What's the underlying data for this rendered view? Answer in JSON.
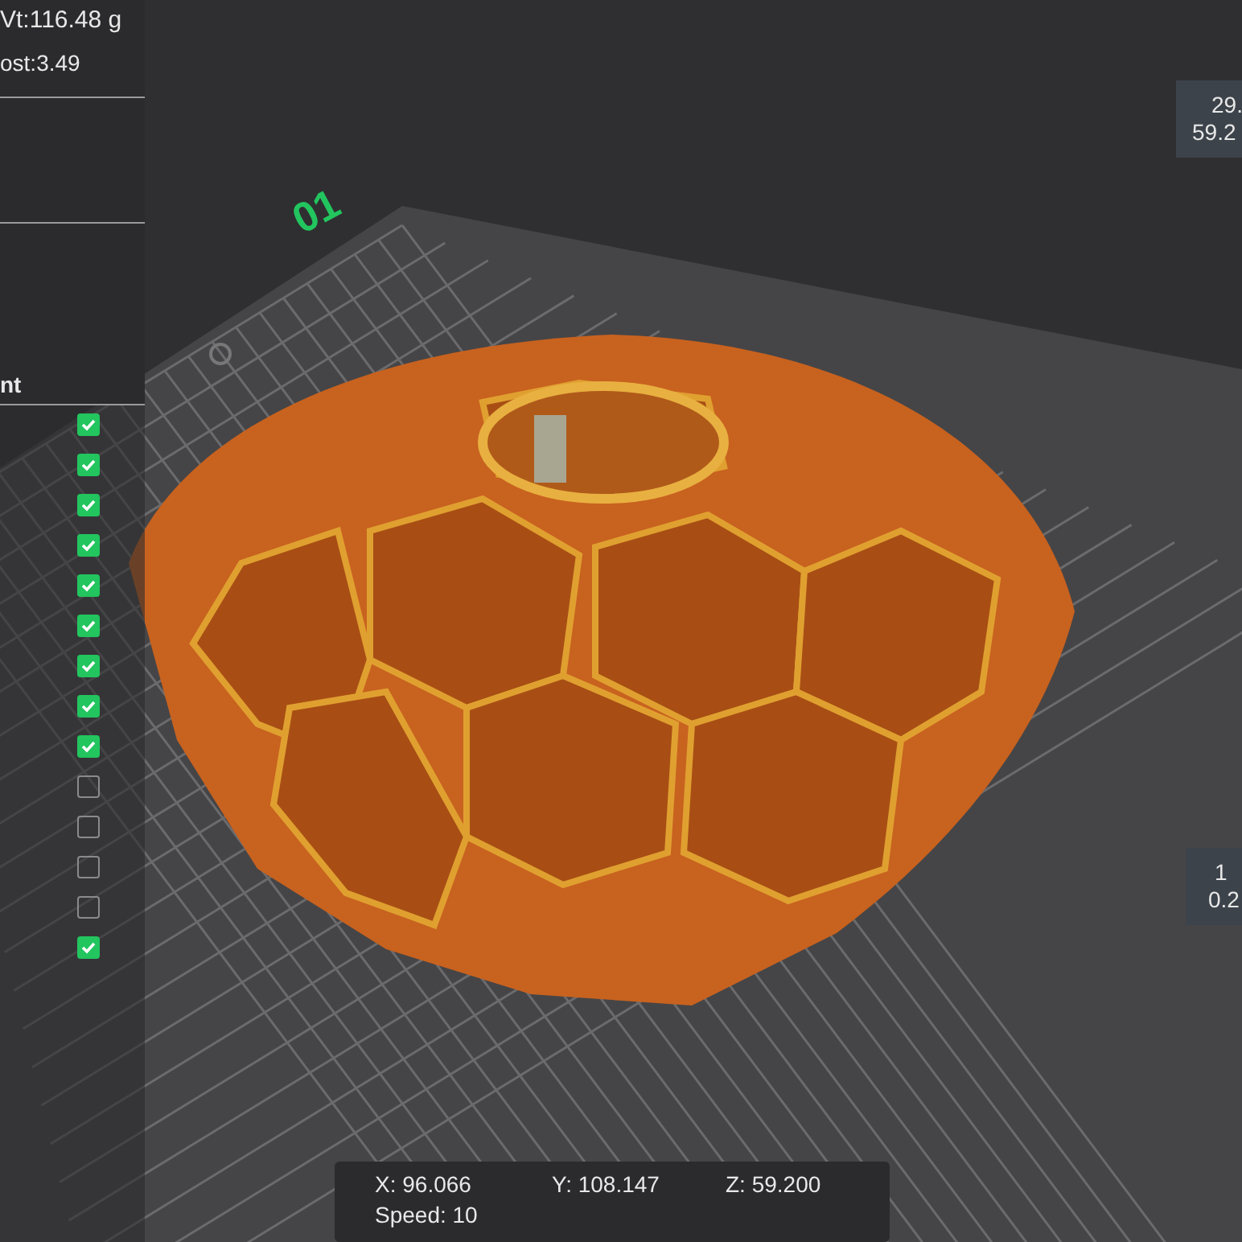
{
  "summary": {
    "weight": "Vt:116.48 g",
    "cost": "ost:3.49"
  },
  "legend": {
    "header": "nt",
    "items": [
      {
        "checked": true
      },
      {
        "checked": true
      },
      {
        "checked": true
      },
      {
        "checked": true
      },
      {
        "checked": true
      },
      {
        "checked": true
      },
      {
        "checked": true
      },
      {
        "checked": true
      },
      {
        "checked": true
      },
      {
        "checked": false
      },
      {
        "checked": false
      },
      {
        "checked": false
      },
      {
        "checked": false
      },
      {
        "checked": true
      }
    ]
  },
  "plate_label": "01",
  "top_slider_tip": {
    "line_1": "29.",
    "line_2": "59.2"
  },
  "bottom_slider_tip": {
    "line_1": "1",
    "line_2": "0.2"
  },
  "position_readout": {
    "x": "X: 96.066",
    "y": "Y: 108.147",
    "z": "Z: 59.200",
    "speed": "Speed: 10"
  }
}
